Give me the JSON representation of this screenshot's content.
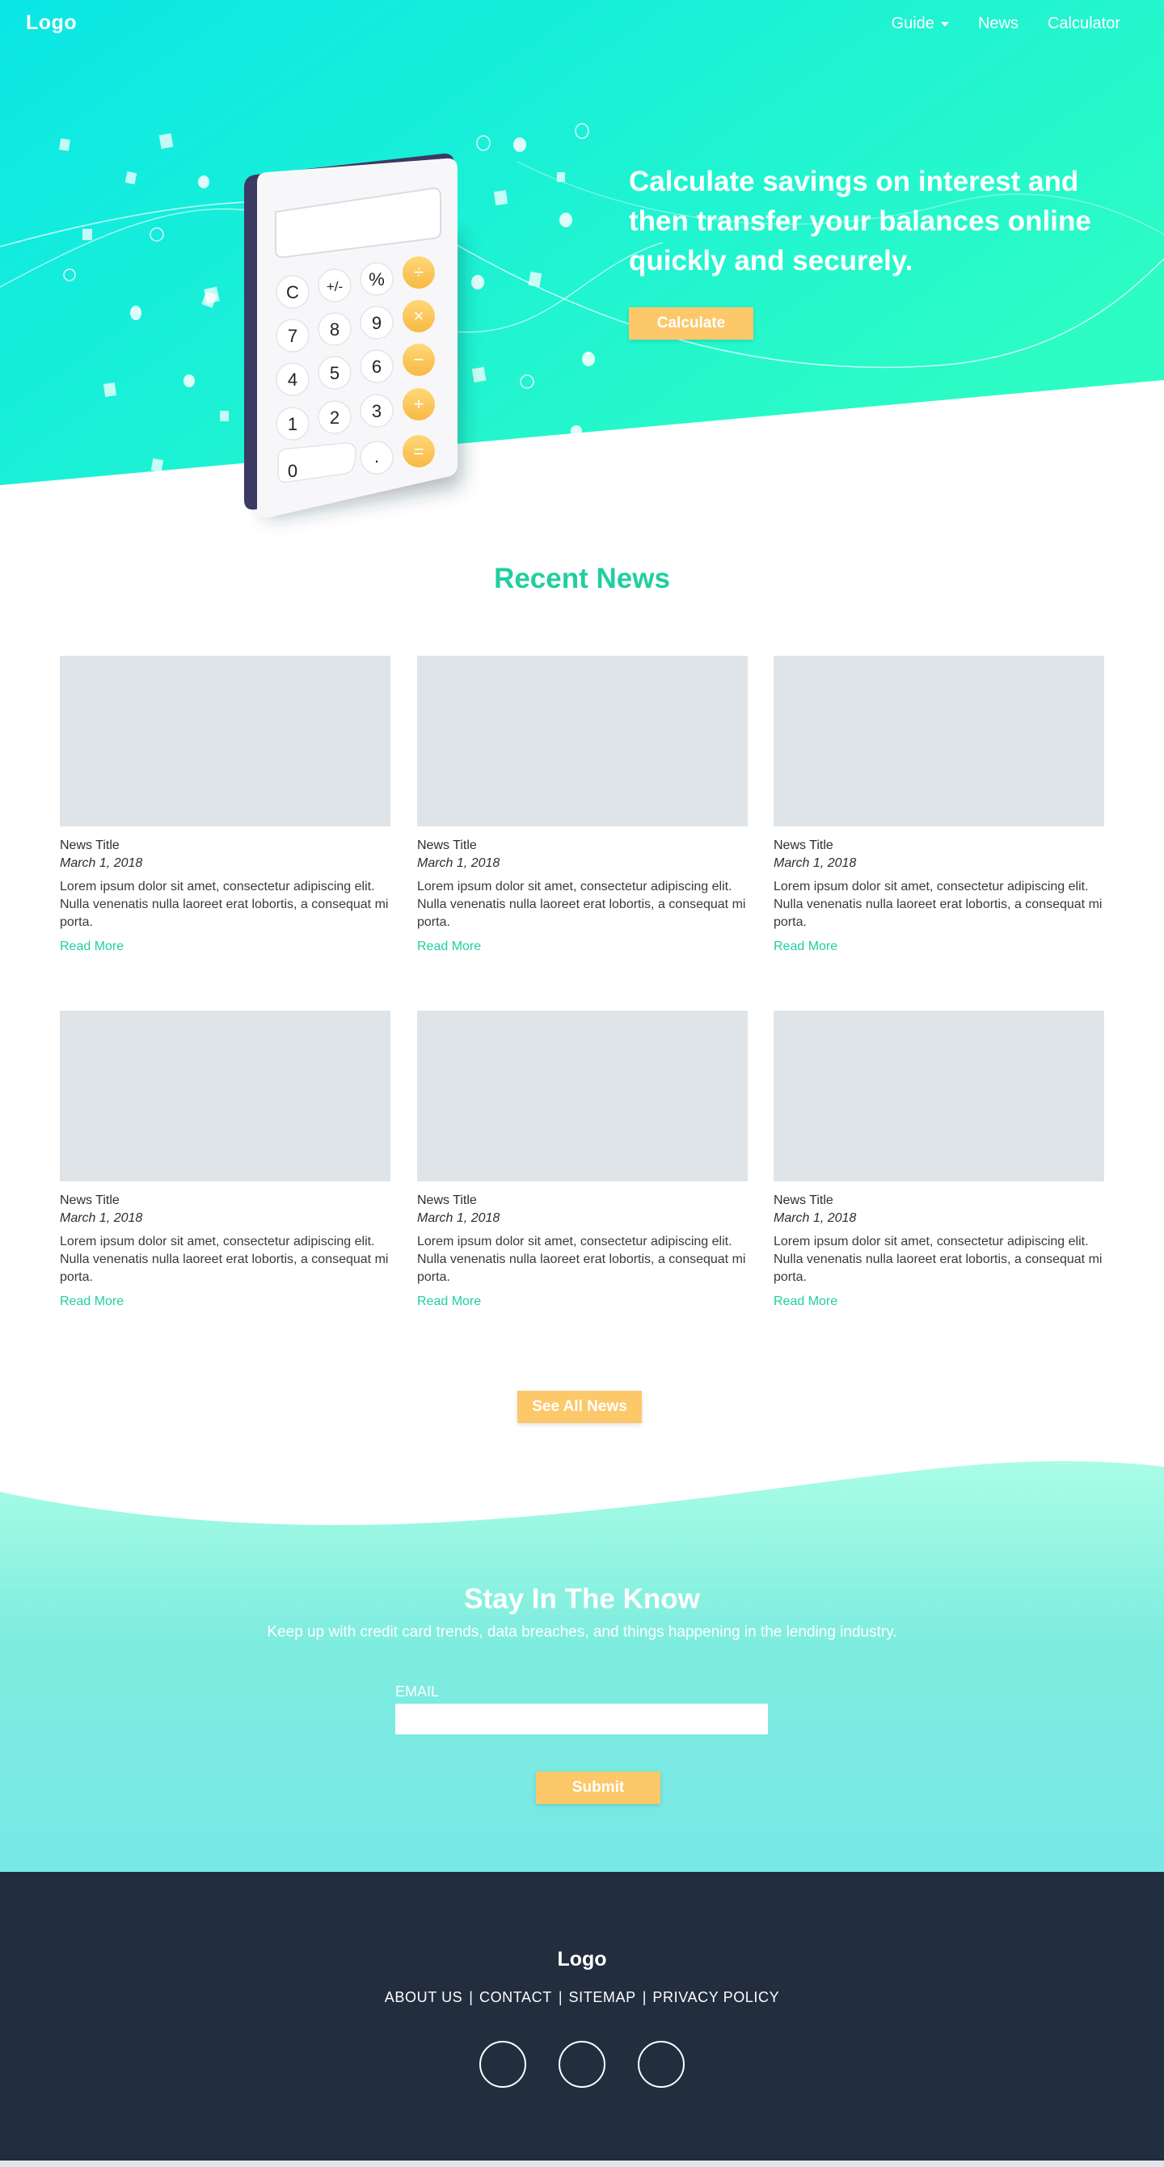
{
  "header": {
    "logo": "Logo",
    "nav": [
      {
        "label": "Guide",
        "has_dropdown": true
      },
      {
        "label": "News"
      },
      {
        "label": "Calculator"
      }
    ]
  },
  "hero": {
    "headline": "Calculate savings on interest and then transfer your balances online quickly and securely.",
    "cta_label": "Calculate",
    "calculator_keys": [
      "C",
      "+/-",
      "%",
      "÷",
      "7",
      "8",
      "9",
      "×",
      "4",
      "5",
      "6",
      "−",
      "1",
      "2",
      "3",
      "+",
      "0",
      ".",
      "="
    ]
  },
  "news": {
    "section_title": "Recent News",
    "articles": [
      {
        "title": "News Title",
        "date": "March 1, 2018",
        "excerpt": "Lorem ipsum dolor sit amet, consectetur adipiscing elit. Nulla venenatis nulla laoreet erat lobortis, a consequat mi porta.",
        "link_label": "Read More"
      },
      {
        "title": "News Title",
        "date": "March 1, 2018",
        "excerpt": "Lorem ipsum dolor sit amet, consectetur adipiscing elit. Nulla venenatis nulla laoreet erat lobortis, a consequat mi porta.",
        "link_label": "Read More"
      },
      {
        "title": "News Title",
        "date": "March 1, 2018",
        "excerpt": "Lorem ipsum dolor sit amet, consectetur adipiscing elit. Nulla venenatis nulla laoreet erat lobortis, a consequat mi porta.",
        "link_label": "Read More"
      },
      {
        "title": "News Title",
        "date": "March 1, 2018",
        "excerpt": "Lorem ipsum dolor sit amet, consectetur adipiscing elit. Nulla venenatis nulla laoreet erat lobortis, a consequat mi porta.",
        "link_label": "Read More"
      },
      {
        "title": "News Title",
        "date": "March 1, 2018",
        "excerpt": "Lorem ipsum dolor sit amet, consectetur adipiscing elit. Nulla venenatis nulla laoreet erat lobortis, a consequat mi porta.",
        "link_label": "Read More"
      },
      {
        "title": "News Title",
        "date": "March 1, 2018",
        "excerpt": "Lorem ipsum dolor sit amet, consectetur adipiscing elit. Nulla venenatis nulla laoreet erat lobortis, a consequat mi porta.",
        "link_label": "Read More"
      }
    ],
    "see_all_label": "See All News"
  },
  "newsletter": {
    "title": "Stay In The Know",
    "subtitle": "Keep up with credit card trends, data breaches, and things happening in the lending industry.",
    "email_label": "EMAIL",
    "email_value": "",
    "email_placeholder": "",
    "submit_label": "Submit"
  },
  "footer": {
    "logo": "Logo",
    "links": [
      "ABOUT US",
      "CONTACT",
      "SITEMAP",
      "PRIVACY POLICY"
    ],
    "separator": "|",
    "social_icons": [
      "social-icon-1",
      "social-icon-2",
      "social-icon-3"
    ]
  },
  "colors": {
    "hero_gradient_start": "#0ae6e6",
    "hero_gradient_end": "#2dfcc4",
    "accent_green": "#20cfa0",
    "button_yellow": "#fcc86a",
    "placeholder_gray": "#dee4e8",
    "newsletter_top": "#aafde6",
    "newsletter_bottom": "#78e8e6",
    "footer_navy": "#222d3e"
  }
}
